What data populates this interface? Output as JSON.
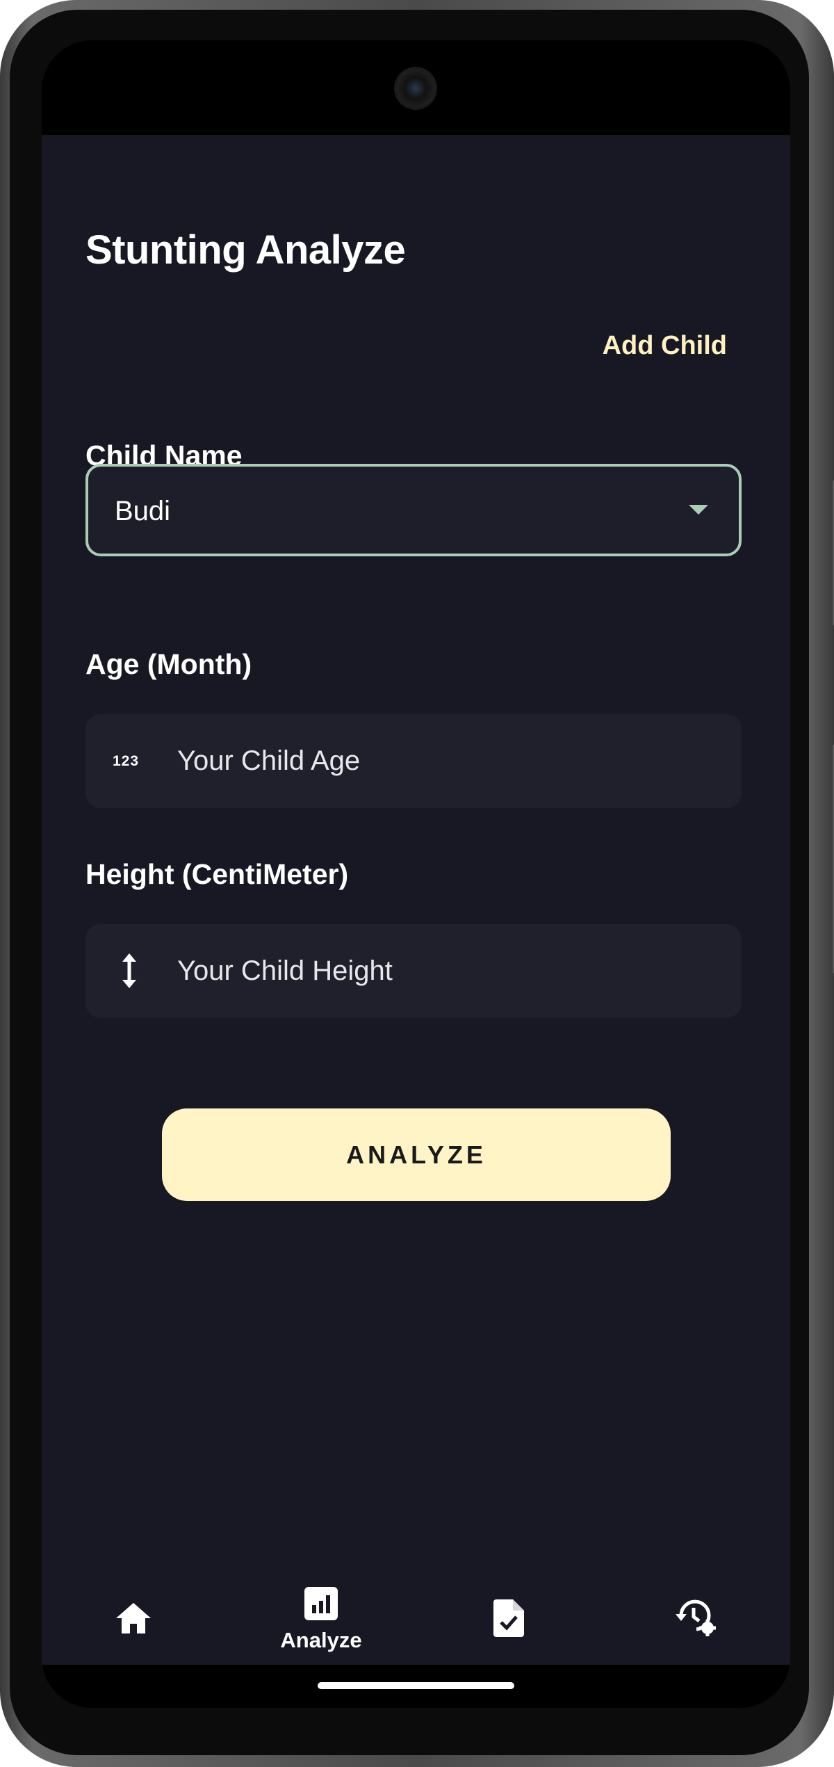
{
  "app": {
    "title": "Stunting Analyze",
    "add_child_label": "Add Child"
  },
  "form": {
    "child_name": {
      "label": "Child Name",
      "selected_value": "Budi"
    },
    "age": {
      "label": "Age (Month)",
      "placeholder": "Your Child Age",
      "icon": "numbers-123-icon"
    },
    "height": {
      "label": "Height (CentiMeter)",
      "placeholder": "Your Child Height",
      "icon": "vertical-arrows-icon"
    },
    "analyze_button": "ANALYZE"
  },
  "bottom_nav": {
    "items": [
      {
        "icon": "home-icon",
        "label": "",
        "active": false
      },
      {
        "icon": "analytics-icon",
        "label": "Analyze",
        "active": true
      },
      {
        "icon": "document-check-icon",
        "label": "",
        "active": false
      },
      {
        "icon": "history-settings-icon",
        "label": "",
        "active": false
      }
    ]
  },
  "colors": {
    "background": "#181824",
    "accent": "#fff4c6",
    "dropdown_border": "#a9cdb6",
    "field_background": "#20202c"
  }
}
